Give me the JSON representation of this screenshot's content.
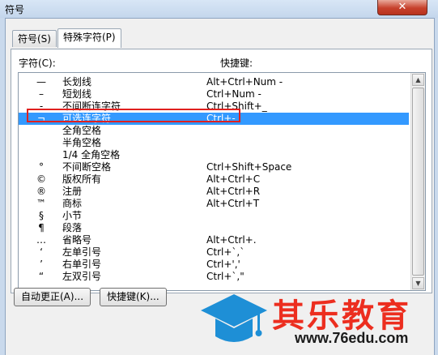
{
  "window": {
    "title": "符号",
    "close_glyph": "✕"
  },
  "tabs": [
    {
      "label": "符号(S)"
    },
    {
      "label": "特殊字符(P)"
    }
  ],
  "list": {
    "header_char": "字符(C):",
    "header_shortcut": "快捷键:",
    "rows": [
      {
        "sym": "—",
        "name": "长划线",
        "key": "Alt+Ctrl+Num -"
      },
      {
        "sym": "–",
        "name": "短划线",
        "key": "Ctrl+Num -"
      },
      {
        "sym": "-",
        "name": "不间断连字符",
        "key": "Ctrl+Shift+_"
      },
      {
        "sym": "¬",
        "name": "可选连字符",
        "key": "Ctrl+-",
        "selected": true
      },
      {
        "sym": "",
        "name": "全角空格",
        "key": ""
      },
      {
        "sym": "",
        "name": "半角空格",
        "key": ""
      },
      {
        "sym": "",
        "name": "1/4 全角空格",
        "key": ""
      },
      {
        "sym": "°",
        "name": "不间断空格",
        "key": "Ctrl+Shift+Space"
      },
      {
        "sym": "©",
        "name": "版权所有",
        "key": "Alt+Ctrl+C"
      },
      {
        "sym": "®",
        "name": "注册",
        "key": "Alt+Ctrl+R"
      },
      {
        "sym": "™",
        "name": "商标",
        "key": "Alt+Ctrl+T"
      },
      {
        "sym": "§",
        "name": "小节",
        "key": ""
      },
      {
        "sym": "¶",
        "name": "段落",
        "key": ""
      },
      {
        "sym": "…",
        "name": "省略号",
        "key": "Alt+Ctrl+."
      },
      {
        "sym": "‘",
        "name": "左单引号",
        "key": "Ctrl+`,`"
      },
      {
        "sym": "’",
        "name": "右单引号",
        "key": "Ctrl+','"
      },
      {
        "sym": "“",
        "name": "左双引号",
        "key": "Ctrl+`,\""
      }
    ]
  },
  "buttons": {
    "autocorrect": "自动更正(A)...",
    "shortcut": "快捷键(K)..."
  },
  "watermark": {
    "title": "其乐教育",
    "url": "www.76edu.com",
    "colors": {
      "red": "#ec2e1f",
      "blue": "#1e8fd6"
    }
  }
}
